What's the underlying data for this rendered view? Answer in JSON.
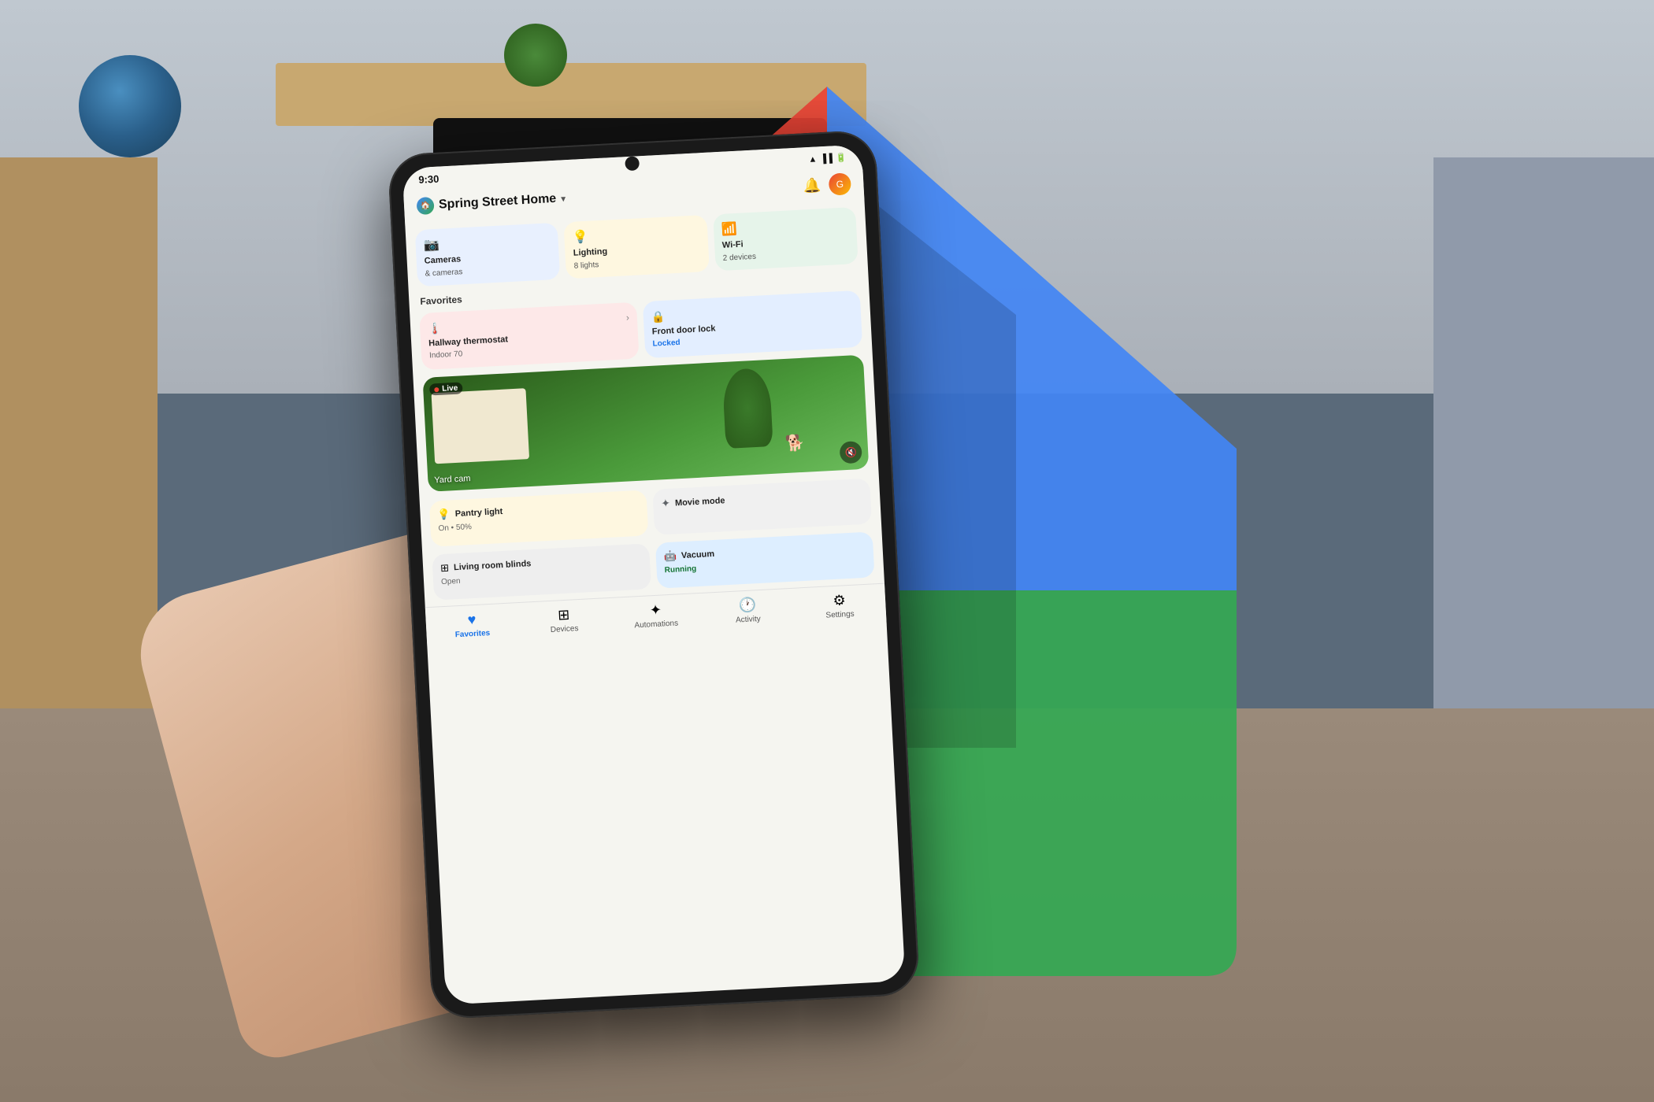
{
  "background": {
    "description": "Living room background"
  },
  "google_home_logo": {
    "colors": {
      "red": "#ea4335",
      "blue": "#4285f4",
      "yellow": "#fbbc04",
      "green": "#34a853"
    }
  },
  "phone": {
    "status_bar": {
      "time": "9:30",
      "icons": "WiFi 4G"
    },
    "header": {
      "home_name": "Spring Street Home",
      "chevron": "▾",
      "bell_icon": "🔔"
    },
    "device_cards": [
      {
        "id": "cameras",
        "icon": "📷",
        "title": "Cameras",
        "subtitle": "& cameras",
        "color": "blue"
      },
      {
        "id": "lighting",
        "icon": "💡",
        "title": "Lighting",
        "subtitle": "8 lights",
        "color": "yellow"
      },
      {
        "id": "wifi",
        "icon": "📶",
        "title": "Wi-Fi",
        "subtitle": "2 devices",
        "color": "green"
      }
    ],
    "favorites_label": "Favorites",
    "favorites": [
      {
        "id": "thermostat",
        "icon": "🌡️",
        "title": "Hallway thermostat",
        "subtitle": "Indoor 70",
        "chevron": "›",
        "color": "red-warm"
      },
      {
        "id": "front-door",
        "icon": "🔒",
        "title": "Front door lock",
        "status": "Locked",
        "color": "blue-light"
      }
    ],
    "camera_feed": {
      "live_label": "Live",
      "yard_label": "Yard cam",
      "mute_icon": "🔇"
    },
    "more_favorites": [
      {
        "id": "pantry-light",
        "icon": "💡",
        "title": "Pantry light",
        "subtitle": "On • 50%",
        "color": "yellow-light"
      },
      {
        "id": "movie-mode",
        "title": "Movie mode",
        "sparkle": "✦",
        "color": "gray-light"
      }
    ],
    "bottom_cards": [
      {
        "id": "living-room-blinds",
        "icon": "⊞",
        "title": "Living room blinds",
        "subtitle": "Open",
        "subtitle_color": "gray",
        "color": "gray"
      },
      {
        "id": "vacuum",
        "icon": "🤖",
        "title": "Vacuum",
        "subtitle": "Running",
        "subtitle_color": "green",
        "color": "blue-soft"
      }
    ],
    "bottom_nav": [
      {
        "id": "favorites",
        "icon": "♥",
        "label": "Favorites",
        "active": true
      },
      {
        "id": "devices",
        "icon": "⊞",
        "label": "Devices",
        "active": false
      },
      {
        "id": "automations",
        "icon": "✦",
        "label": "Automations",
        "active": false
      },
      {
        "id": "activity",
        "icon": "🕐",
        "label": "Activity",
        "active": false
      },
      {
        "id": "settings",
        "icon": "⚙",
        "label": "Settings",
        "active": false
      }
    ]
  }
}
